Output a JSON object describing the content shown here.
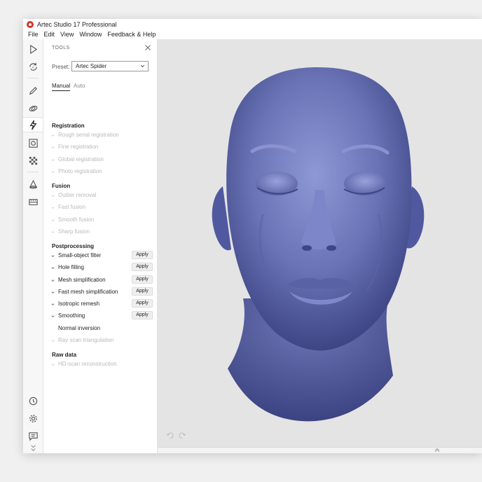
{
  "window": {
    "title": "Artec Studio 17 Professional"
  },
  "menu": [
    "File",
    "Edit",
    "View",
    "Window",
    "Feedback & Help"
  ],
  "toolbar": {
    "items": [
      {
        "icon": "play-icon"
      },
      {
        "icon": "scan-sync-icon"
      },
      {
        "icon": "pencil-icon"
      },
      {
        "icon": "pills-icon"
      },
      {
        "icon": "tools-icon",
        "active": true
      },
      {
        "icon": "target-icon"
      },
      {
        "icon": "checkerboard-icon"
      },
      {
        "icon": "cone-icon"
      },
      {
        "icon": "measure-icon"
      },
      {
        "icon": "history-icon"
      },
      {
        "icon": "gear-icon"
      },
      {
        "icon": "chat-icon"
      },
      {
        "icon": "double-chevron-down-icon"
      }
    ]
  },
  "panel": {
    "title": "TOOLS",
    "preset_label": "Preset:",
    "preset_value": "Artec Spider",
    "tabs": [
      "Manual",
      "Auto"
    ],
    "active_tab": "Manual",
    "apply_label": "Apply",
    "sections": [
      {
        "heading": "Registration",
        "items": [
          {
            "label": "Rough serial registration",
            "enabled": false,
            "chevron": true
          },
          {
            "label": "Fine registration",
            "enabled": false,
            "chevron": true
          },
          {
            "label": "Global registration",
            "enabled": false,
            "chevron": true
          },
          {
            "label": "Photo registration",
            "enabled": false,
            "chevron": true
          }
        ]
      },
      {
        "heading": "Fusion",
        "items": [
          {
            "label": "Outlier removal",
            "enabled": false,
            "chevron": true
          },
          {
            "label": "Fast fusion",
            "enabled": false,
            "chevron": true
          },
          {
            "label": "Smooth fusion",
            "enabled": false,
            "chevron": true
          },
          {
            "label": "Sharp fusion",
            "enabled": false,
            "chevron": true
          }
        ]
      },
      {
        "heading": "Postprocessing",
        "items": [
          {
            "label": "Small-object filter",
            "enabled": true,
            "chevron": true,
            "apply": true
          },
          {
            "label": "Hole filling",
            "enabled": true,
            "chevron": true,
            "apply": true
          },
          {
            "label": "Mesh simplification",
            "enabled": true,
            "chevron": true,
            "apply": true
          },
          {
            "label": "Fast mesh simplification",
            "enabled": true,
            "chevron": true,
            "apply": true
          },
          {
            "label": "Isotropic remesh",
            "enabled": true,
            "chevron": true,
            "apply": true
          },
          {
            "label": "Smoothing",
            "enabled": true,
            "chevron": true,
            "apply": true
          },
          {
            "label": "Normal inversion",
            "enabled": true,
            "chevron": false
          },
          {
            "label": "Ray scan triangulation",
            "enabled": false,
            "chevron": true
          }
        ]
      },
      {
        "heading": "Raw data",
        "items": [
          {
            "label": "HD-scan reconstruction",
            "enabled": false,
            "chevron": true
          }
        ]
      }
    ]
  },
  "viewport": {
    "model": "3D scan of human head",
    "model_color": "#6a73b5"
  },
  "colors": {
    "accent": "#d9342b",
    "mesh": "#6a73b5"
  }
}
